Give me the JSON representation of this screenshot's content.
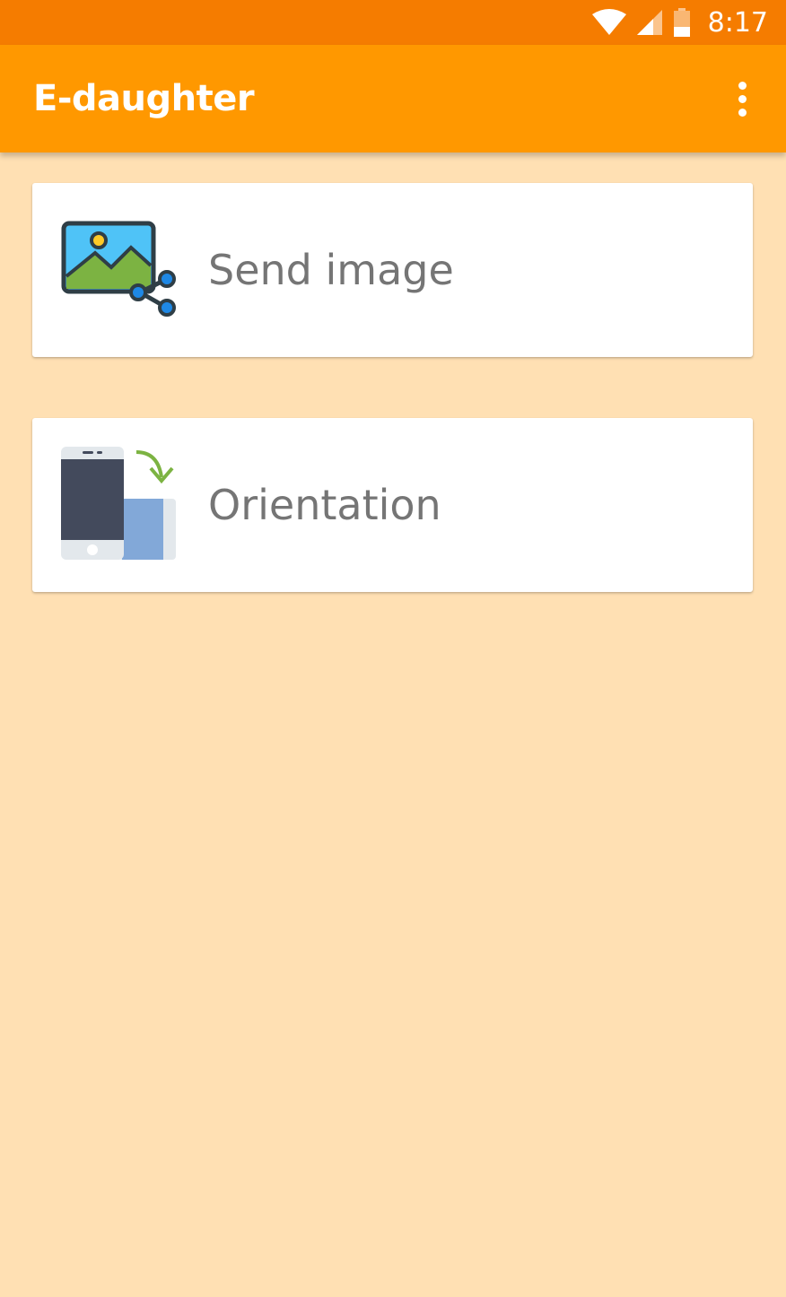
{
  "status_bar": {
    "time": "8:17",
    "icons": [
      "wifi-icon",
      "cell-signal-icon",
      "battery-icon"
    ],
    "color": "#F57C00"
  },
  "app_bar": {
    "title": "E-daughter",
    "menu_icon": "more-vertical-icon",
    "color": "#FF9800"
  },
  "background_color": "#FFE0B3",
  "cards": [
    {
      "label": "Send image",
      "icon": "share-image-icon"
    },
    {
      "label": "Orientation",
      "icon": "screen-rotation-icon"
    }
  ]
}
